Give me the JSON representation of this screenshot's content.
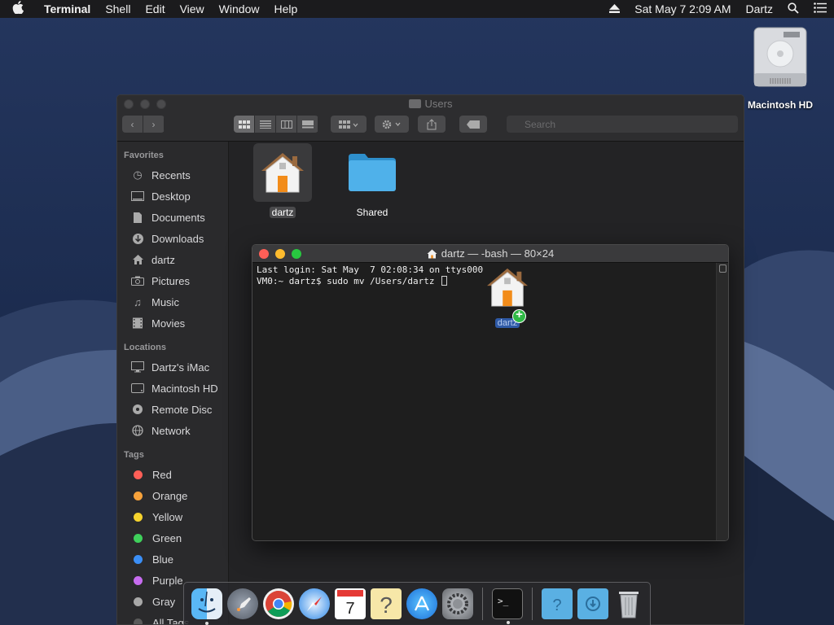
{
  "menubar": {
    "apple_icon": "apple-icon",
    "app_name": "Terminal",
    "menus": [
      "Shell",
      "Edit",
      "View",
      "Window",
      "Help"
    ],
    "clock": "Sat May 7  2:09 AM",
    "user": "Dartz",
    "icons": [
      "eject-icon",
      "spotlight-icon",
      "notification-center-icon"
    ]
  },
  "desktop": {
    "drive_label": "Macintosh HD"
  },
  "finder": {
    "title": "Users",
    "search_placeholder": "Search",
    "sidebar": {
      "favorites_header": "Favorites",
      "favorites": [
        {
          "label": "Recents",
          "icon": "clock-icon"
        },
        {
          "label": "Desktop",
          "icon": "desktop-icon"
        },
        {
          "label": "Documents",
          "icon": "document-icon"
        },
        {
          "label": "Downloads",
          "icon": "download-icon"
        },
        {
          "label": "dartz",
          "icon": "home-icon"
        },
        {
          "label": "Pictures",
          "icon": "camera-icon"
        },
        {
          "label": "Music",
          "icon": "music-icon"
        },
        {
          "label": "Movies",
          "icon": "film-icon"
        }
      ],
      "locations_header": "Locations",
      "locations": [
        {
          "label": "Dartz's iMac",
          "icon": "imac-icon"
        },
        {
          "label": "Macintosh HD",
          "icon": "disk-icon"
        },
        {
          "label": "Remote Disc",
          "icon": "disc-icon"
        },
        {
          "label": "Network",
          "icon": "globe-icon"
        }
      ],
      "tags_header": "Tags",
      "tags": [
        {
          "label": "Red",
          "color": "#ff5f57"
        },
        {
          "label": "Orange",
          "color": "#f7a23b"
        },
        {
          "label": "Yellow",
          "color": "#f6d32d"
        },
        {
          "label": "Green",
          "color": "#3fd05b"
        },
        {
          "label": "Blue",
          "color": "#3b8ff6"
        },
        {
          "label": "Purple",
          "color": "#c76cf0"
        },
        {
          "label": "Gray",
          "color": "#a8a8a8"
        },
        {
          "label": "All Tags...",
          "color": "#5a5a5a"
        }
      ]
    },
    "files": [
      {
        "name": "dartz",
        "kind": "home-folder",
        "selected": true
      },
      {
        "name": "Shared",
        "kind": "folder",
        "selected": false
      }
    ]
  },
  "terminal": {
    "title": "dartz — -bash — 80×24",
    "lines": [
      "Last login: Sat May  7 02:08:34 on ttys000",
      "VM0:~ dartz$ sudo mv /Users/dartz "
    ]
  },
  "drag": {
    "label": "dartz"
  },
  "dock": {
    "apps": [
      "Finder",
      "Launchpad",
      "Google Chrome",
      "Safari",
      "Calendar",
      "Help Viewer",
      "App Store",
      "System Preferences",
      "Terminal",
      "Help Folder",
      "Downloads Folder",
      "Trash"
    ]
  }
}
